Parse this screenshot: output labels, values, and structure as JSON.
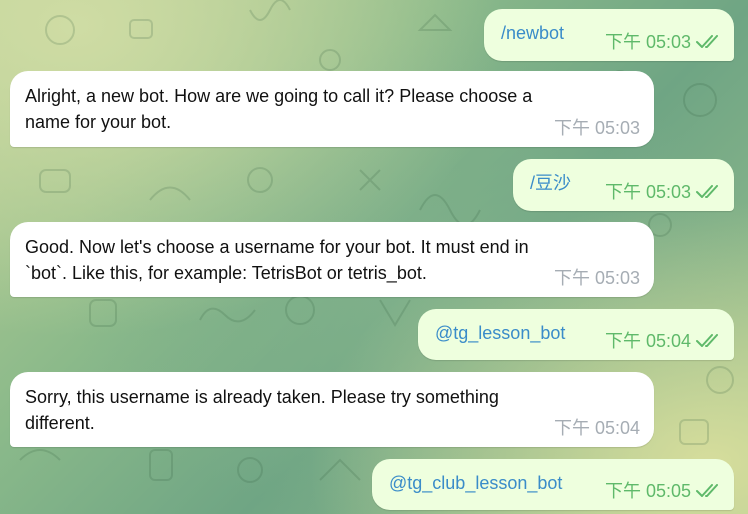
{
  "messages": [
    {
      "direction": "out",
      "text": "/newbot",
      "time": "下午 05:03",
      "status_icon": "double-check-icon"
    },
    {
      "direction": "in",
      "text": "Alright, a new bot. How are we going to call it? Please choose a\nname for your bot.",
      "time": "下午 05:03"
    },
    {
      "direction": "out",
      "text": "/豆沙",
      "time": "下午 05:03",
      "status_icon": "double-check-icon"
    },
    {
      "direction": "in",
      "text": "Good. Now let's choose a username for your bot. It must end in\n`bot`. Like this, for example: TetrisBot or tetris_bot.",
      "time": "下午 05:03"
    },
    {
      "direction": "out",
      "text": "@tg_lesson_bot",
      "time": "下午 05:04",
      "status_icon": "double-check-icon"
    },
    {
      "direction": "in",
      "text": "Sorry, this username is already taken. Please try something\ndifferent.",
      "time": "下午 05:04"
    },
    {
      "direction": "out",
      "text": "@tg_club_lesson_bot",
      "time": "下午 05:05",
      "status_icon": "double-check-icon"
    }
  ],
  "colors": {
    "incoming_bubble": "#ffffff",
    "outgoing_bubble": "#eeffde",
    "outgoing_text": "#3a8cc9",
    "outgoing_meta": "#5fb96a",
    "incoming_meta": "#a6adb4"
  }
}
